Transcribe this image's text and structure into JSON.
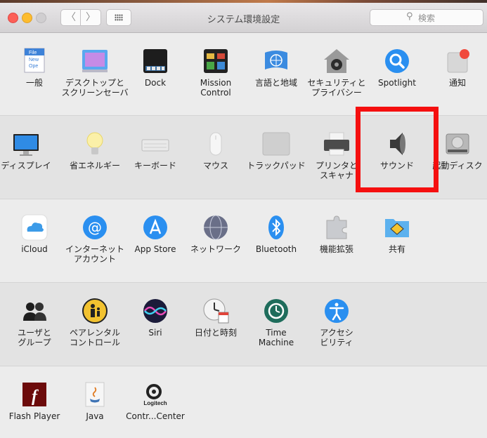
{
  "window": {
    "title": "システム環境設定",
    "search_icon": "⚲",
    "search_placeholder": "検索",
    "back_label": "〈",
    "forward_label": "〉"
  },
  "rows": [
    [
      {
        "label": "一般",
        "icon": "file-doc-icon"
      },
      {
        "label": "デスクトップと\nスクリーンセーバ",
        "icon": "desktop-icon"
      },
      {
        "label": "Dock",
        "icon": "dock-icon"
      },
      {
        "label": "Mission\nControl",
        "icon": "mission-control-icon"
      },
      {
        "label": "言語と地域",
        "icon": "globe-flag-icon"
      },
      {
        "label": "セキュリティと\nプライバシー",
        "icon": "house-lock-icon"
      },
      {
        "label": "Spotlight",
        "icon": "magnifier-icon"
      },
      {
        "label": "通知",
        "icon": "notification-icon"
      }
    ],
    [
      {
        "label": "ディスプレイ",
        "icon": "monitor-icon"
      },
      {
        "label": "省エネルギー",
        "icon": "lightbulb-icon"
      },
      {
        "label": "キーボード",
        "icon": "keyboard-icon"
      },
      {
        "label": "マウス",
        "icon": "mouse-icon"
      },
      {
        "label": "トラックパッド",
        "icon": "trackpad-icon"
      },
      {
        "label": "プリンタと\nスキャナ",
        "icon": "printer-icon"
      },
      {
        "label": "サウンド",
        "icon": "speaker-icon"
      },
      {
        "label": "起動ディスク",
        "icon": "hard-disk-icon"
      }
    ],
    [
      {
        "label": "iCloud",
        "icon": "cloud-icon"
      },
      {
        "label": "インターネット\nアカウント",
        "icon": "at-sign-icon"
      },
      {
        "label": "App Store",
        "icon": "app-store-icon"
      },
      {
        "label": "ネットワーク",
        "icon": "network-globe-icon"
      },
      {
        "label": "Bluetooth",
        "icon": "bluetooth-icon"
      },
      {
        "label": "機能拡張",
        "icon": "puzzle-icon"
      },
      {
        "label": "共有",
        "icon": "sharing-folder-icon"
      }
    ],
    [
      {
        "label": "ユーザと\nグループ",
        "icon": "users-icon"
      },
      {
        "label": "ペアレンタル\nコントロール",
        "icon": "parental-icon"
      },
      {
        "label": "Siri",
        "icon": "siri-icon"
      },
      {
        "label": "日付と時刻",
        "icon": "clock-calendar-icon"
      },
      {
        "label": "Time\nMachine",
        "icon": "time-machine-icon"
      },
      {
        "label": "アクセシ\nビリティ",
        "icon": "accessibility-icon"
      }
    ],
    [
      {
        "label": "Flash Player",
        "icon": "flash-icon"
      },
      {
        "label": "Java",
        "icon": "java-icon"
      },
      {
        "label": "Contr...Center",
        "icon": "logitech-icon"
      }
    ]
  ],
  "accent_highlight": "#f50f0f"
}
